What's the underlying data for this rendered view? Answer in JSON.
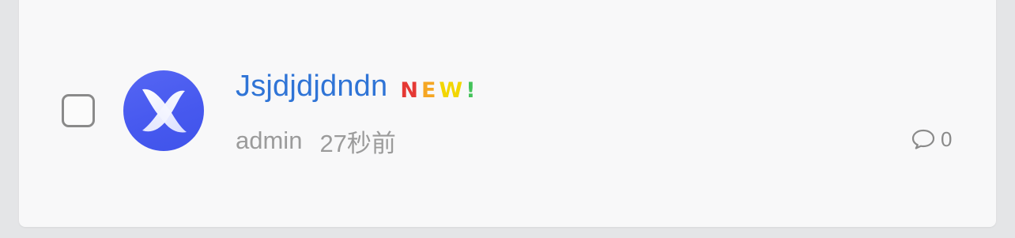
{
  "post": {
    "title": "Jsjdjdjdndn",
    "badge": {
      "letters": [
        {
          "char": "N",
          "color": "#e53935"
        },
        {
          "char": "E",
          "color": "#f5a623"
        },
        {
          "char": "W",
          "color": "#f2d600"
        },
        {
          "char": "!",
          "color": "#43c35a"
        }
      ]
    },
    "author": "admin",
    "time": "27秒前",
    "comment_count": "0",
    "checked": false
  },
  "icons": {
    "avatar": "x-logo-icon",
    "comments": "comment-bubble-icon"
  },
  "colors": {
    "title": "#2f74d6",
    "meta": "#9b9b9b",
    "avatar_bg": "#4759ef"
  }
}
